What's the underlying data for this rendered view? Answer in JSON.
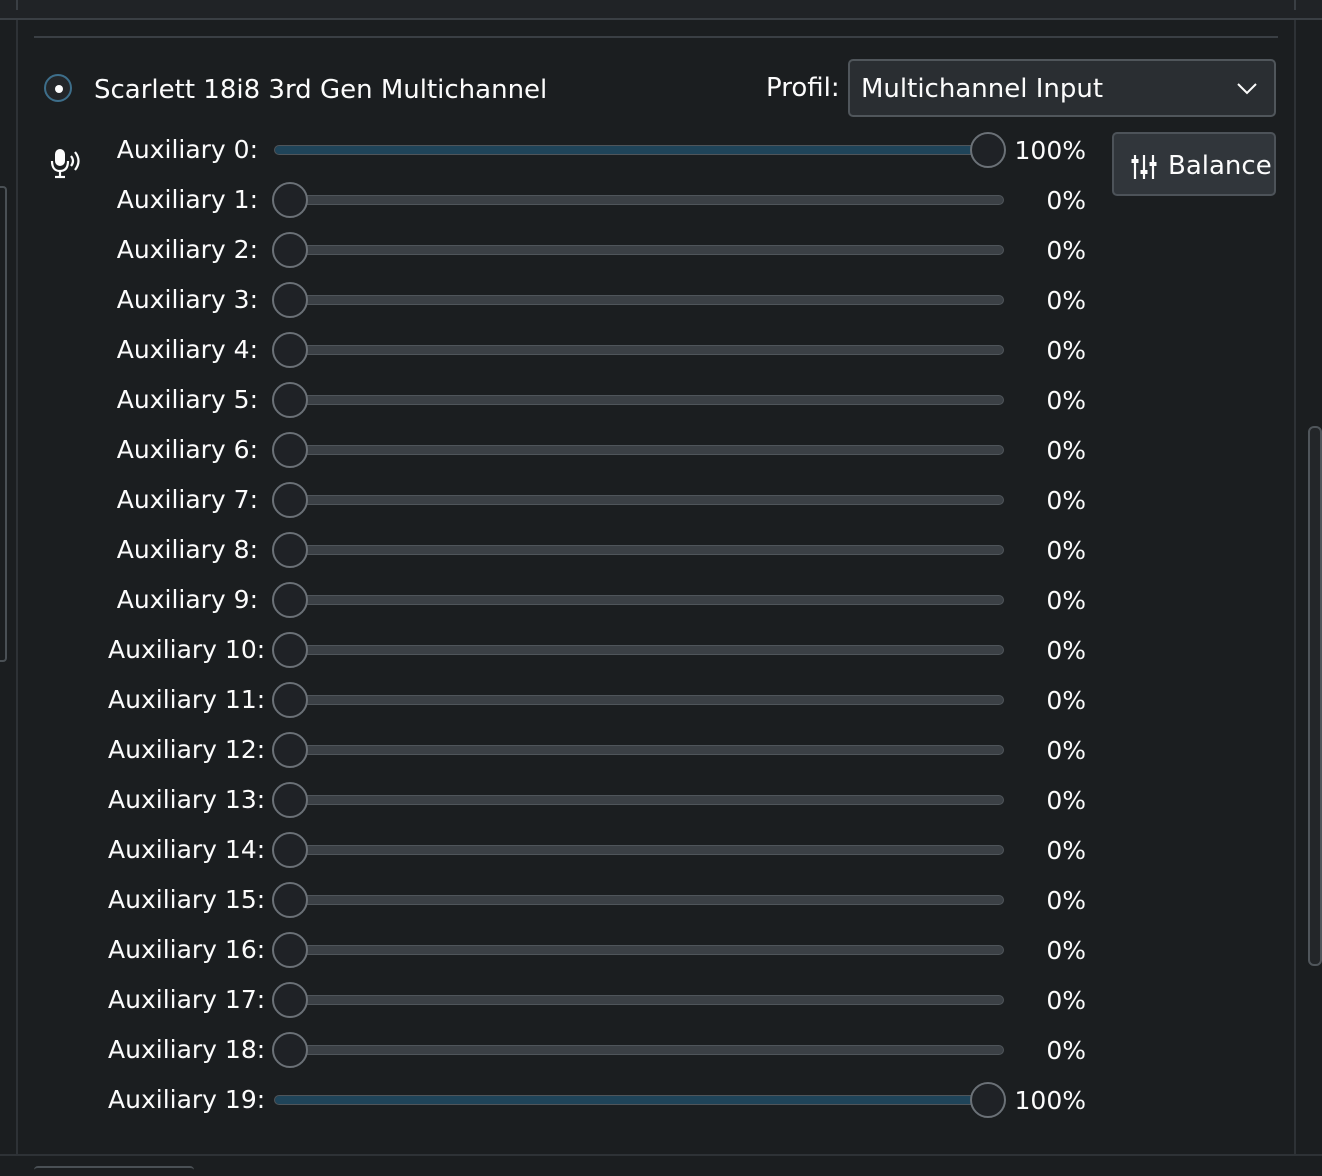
{
  "device": {
    "name": "Scarlett 18i8 3rd Gen Multichannel",
    "selected": true,
    "icon": "microphone-sensitivity-icon"
  },
  "profile": {
    "label": "Profil:",
    "value": "Multichannel Input"
  },
  "balance_button": {
    "label": "Balance",
    "icon": "sliders-icon"
  },
  "channels": [
    {
      "label": "Auxiliary 0:",
      "value": "100%",
      "level": 1
    },
    {
      "label": "Auxiliary 1:",
      "value": "0%",
      "level": 0
    },
    {
      "label": "Auxiliary 2:",
      "value": "0%",
      "level": 0
    },
    {
      "label": "Auxiliary 3:",
      "value": "0%",
      "level": 0
    },
    {
      "label": "Auxiliary 4:",
      "value": "0%",
      "level": 0
    },
    {
      "label": "Auxiliary 5:",
      "value": "0%",
      "level": 0
    },
    {
      "label": "Auxiliary 6:",
      "value": "0%",
      "level": 0
    },
    {
      "label": "Auxiliary 7:",
      "value": "0%",
      "level": 0
    },
    {
      "label": "Auxiliary 8:",
      "value": "0%",
      "level": 0
    },
    {
      "label": "Auxiliary 9:",
      "value": "0%",
      "level": 0
    },
    {
      "label": "Auxiliary 10:",
      "value": "0%",
      "level": 0
    },
    {
      "label": "Auxiliary 11:",
      "value": "0%",
      "level": 0
    },
    {
      "label": "Auxiliary 12:",
      "value": "0%",
      "level": 0
    },
    {
      "label": "Auxiliary 13:",
      "value": "0%",
      "level": 0
    },
    {
      "label": "Auxiliary 14:",
      "value": "0%",
      "level": 0
    },
    {
      "label": "Auxiliary 15:",
      "value": "0%",
      "level": 0
    },
    {
      "label": "Auxiliary 16:",
      "value": "0%",
      "level": 0
    },
    {
      "label": "Auxiliary 17:",
      "value": "0%",
      "level": 0
    },
    {
      "label": "Auxiliary 18:",
      "value": "0%",
      "level": 0
    },
    {
      "label": "Auxiliary 19:",
      "value": "100%",
      "level": 1
    }
  ],
  "colors": {
    "background": "#1b1e20",
    "accent": "#3d6e8a",
    "slider_fill": "#1f4459",
    "text": "#fcfcfc"
  }
}
